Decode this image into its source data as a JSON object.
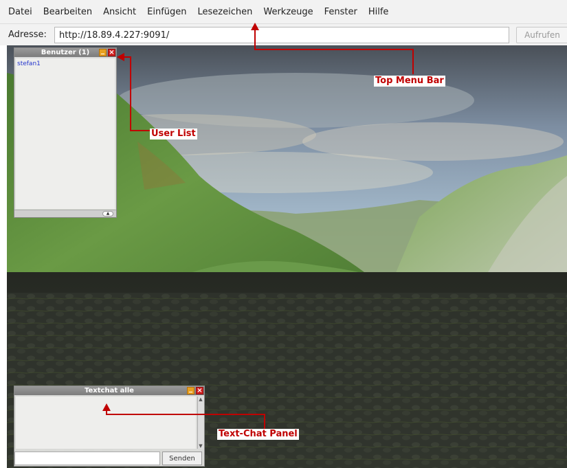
{
  "menubar": {
    "items": [
      {
        "label": "Datei"
      },
      {
        "label": "Bearbeiten"
      },
      {
        "label": "Ansicht"
      },
      {
        "label": "Einfügen"
      },
      {
        "label": "Lesezeichen"
      },
      {
        "label": "Werkzeuge"
      },
      {
        "label": "Fenster"
      },
      {
        "label": "Hilfe"
      }
    ]
  },
  "addressbar": {
    "label": "Adresse:",
    "url": "http://18.89.4.227:9091/",
    "go_label": "Aufrufen"
  },
  "user_list": {
    "title": "Benutzer (1)",
    "users": [
      "stefan1"
    ]
  },
  "text_chat": {
    "title": "Textchat alle",
    "send_label": "Senden",
    "input_value": ""
  },
  "annotations": {
    "menu": "Top Menu Bar",
    "users": "User List",
    "chat": "Text-Chat Panel"
  },
  "colors": {
    "annotation": "#c00000",
    "username": "#2233cc",
    "close_button": "#d02020",
    "minimize_button": "#e8a020"
  }
}
